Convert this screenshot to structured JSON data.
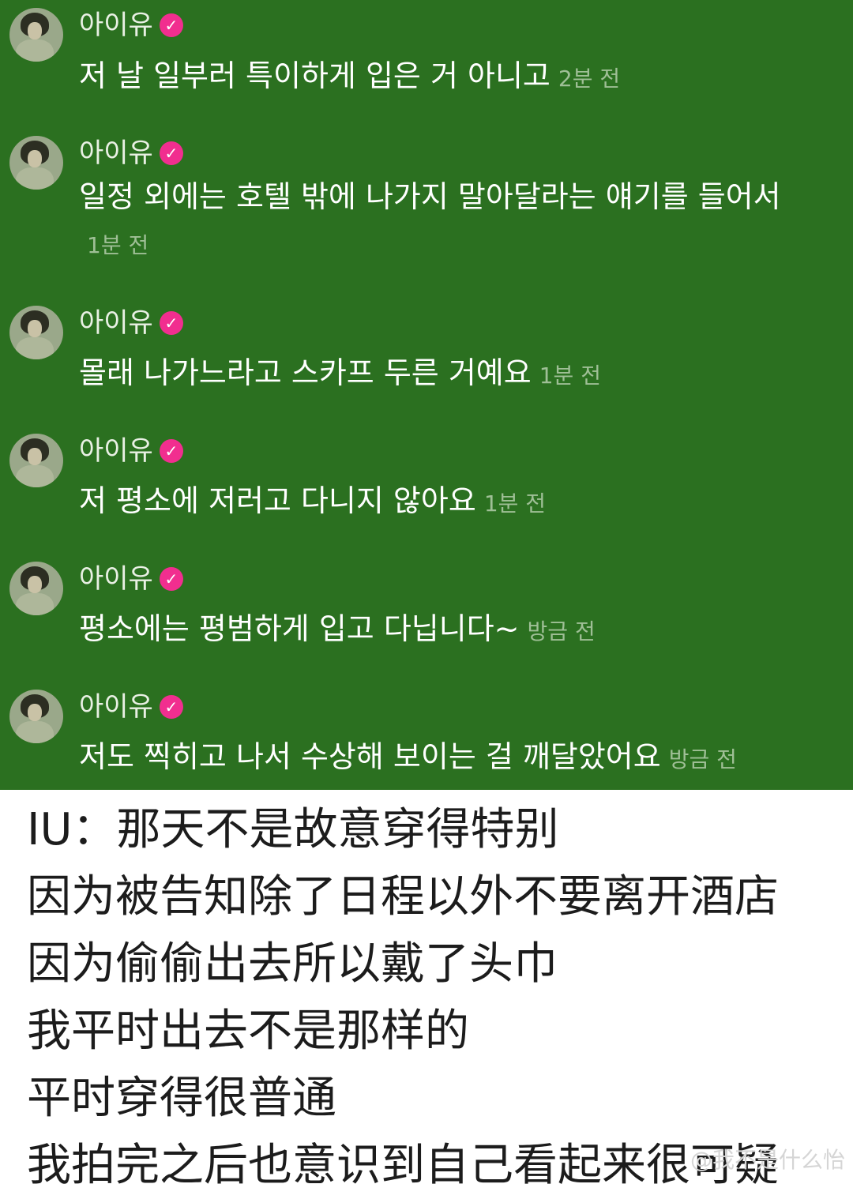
{
  "messages": [
    {
      "author": "아이유",
      "text": "저 날 일부러 특이하게 입은 거 아니고",
      "time": "2분 전"
    },
    {
      "author": "아이유",
      "text": "일정 외에는 호텔 밖에 나가지 말아달라는 얘기를 들어서",
      "time": "1분 전"
    },
    {
      "author": "아이유",
      "text": "몰래 나가느라고 스카프 두른 거예요",
      "time": "1분 전"
    },
    {
      "author": "아이유",
      "text": "저 평소에 저러고 다니지 않아요",
      "time": "1분 전"
    },
    {
      "author": "아이유",
      "text": "평소에는 평범하게 입고 다닙니다~",
      "time": "방금 전"
    },
    {
      "author": "아이유",
      "text": "저도 찍히고 나서 수상해 보이는 걸 깨달았어요",
      "time": "방금 전"
    }
  ],
  "badge_icon": "verified-check-icon",
  "badge_glyph": "✓",
  "colors": {
    "chat_bg": "#2b7020",
    "badge": "#f12e8f",
    "caption_text": "#1c1c1c"
  },
  "caption": {
    "lines": [
      "IU：那天不是故意穿得特别",
      "因为被告知除了日程以外不要离开酒店",
      "因为偷偷出去所以戴了头巾",
      "我平时出去不是那样的",
      "平时穿得很普通",
      "我拍完之后也意识到自己看起来很可疑"
    ]
  },
  "watermark": "@我不是什么怡"
}
